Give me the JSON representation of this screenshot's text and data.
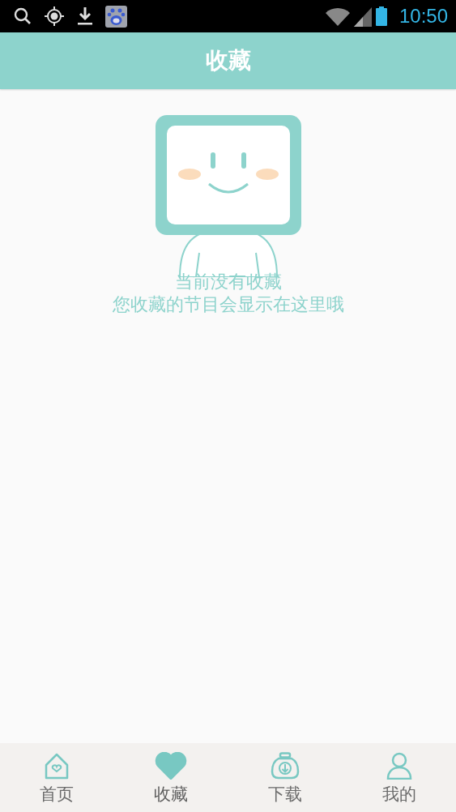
{
  "status_bar": {
    "time": "10:50"
  },
  "header": {
    "title": "收藏"
  },
  "empty_state": {
    "title": "当前没有收藏",
    "message": "您收藏的节目会显示在这里哦"
  },
  "tabs": [
    {
      "label": "首页",
      "kind": "home",
      "selected": false
    },
    {
      "label": "收藏",
      "kind": "favorite",
      "selected": true
    },
    {
      "label": "下载",
      "kind": "download",
      "selected": false
    },
    {
      "label": "我的",
      "kind": "profile",
      "selected": false
    }
  ]
}
